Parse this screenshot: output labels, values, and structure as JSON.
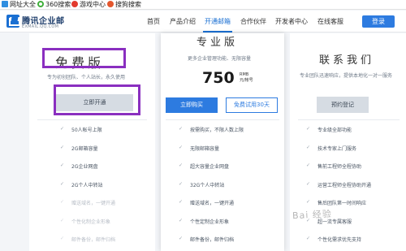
{
  "bookmarks": [
    {
      "label": "网址大全",
      "icon": "grid-icon",
      "color": "#2f8ee0"
    },
    {
      "label": "360搜索",
      "icon": "360-icon",
      "color": "#3fae3a"
    },
    {
      "label": "游戏中心",
      "icon": "game-icon",
      "color": "#e23a2e"
    },
    {
      "label": "搜狗搜索",
      "icon": "sogou-icon",
      "color": "#e4572e"
    }
  ],
  "brand": {
    "name": "腾讯企业邮",
    "domain": "EXMAIL.QQ.COM",
    "color": "#1a6fd2"
  },
  "nav": {
    "items": [
      "首页",
      "产品介绍",
      "开通邮箱",
      "合作伙伴",
      "开发者中心",
      "在线客服"
    ],
    "active": "开通邮箱",
    "login": "登录"
  },
  "plans": {
    "free": {
      "title": "免费版",
      "subtitle": "专为初创团队、个人站长，永久使用",
      "button": "立即开通",
      "features": [
        {
          "text": "50人帐号上限",
          "enabled": true
        },
        {
          "text": "2G邮箱容量",
          "enabled": true
        },
        {
          "text": "2G企业网盘",
          "enabled": true
        },
        {
          "text": "2G个人中转站",
          "enabled": true
        },
        {
          "text": "赠送域名，一键开通",
          "enabled": false
        },
        {
          "text": "个性化制企业形象",
          "enabled": false
        },
        {
          "text": "邮件备份，邮件归档",
          "enabled": false
        }
      ]
    },
    "pro": {
      "title": "专业版",
      "subtitle": "更多企业管理功能、无限容量",
      "price": "750",
      "price_unit": "RMB",
      "price_period": "元/帐号",
      "buy_button": "立即购买",
      "trial_button": "免费试用30天",
      "features": [
        {
          "text": "按需购买，不限人数上限",
          "enabled": true
        },
        {
          "text": "无限邮箱容量",
          "enabled": true
        },
        {
          "text": "超大容量企业网盘",
          "enabled": true
        },
        {
          "text": "32G个人中转站",
          "enabled": true
        },
        {
          "text": "赠送域名，一键开通",
          "enabled": true
        },
        {
          "text": "个性定制企业形象",
          "enabled": true
        },
        {
          "text": "邮件备份，邮件归档",
          "enabled": true
        }
      ]
    },
    "contact": {
      "title": "联系我们",
      "subtitle": "专业团队迅速响应，提供本地化一对一服务",
      "button": "预约登记",
      "features": [
        {
          "text": "专业级全部功能",
          "enabled": true
        },
        {
          "text": "技术专家上门服务",
          "enabled": true
        },
        {
          "text": "售前工程师全程协助",
          "enabled": true
        },
        {
          "text": "运营工程师全程协助开通",
          "enabled": true
        },
        {
          "text": "售后团队第一时间响应",
          "enabled": true
        },
        {
          "text": "超一流专属客服",
          "enabled": true
        },
        {
          "text": "个性化需求优先支持",
          "enabled": true
        }
      ]
    }
  },
  "watermark": "Bai 经验",
  "colors": {
    "accent": "#2d7be0",
    "highlight": "#8a2fc0"
  }
}
